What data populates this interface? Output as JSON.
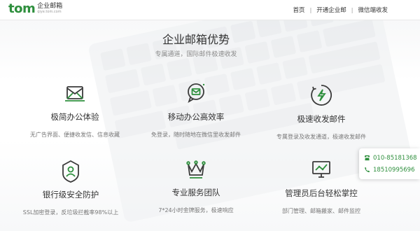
{
  "header": {
    "logo_brand": "tom",
    "logo_cn": "企业邮箱",
    "logo_en": "qiye.tom.com",
    "nav": [
      "首页",
      "开通企业邮",
      "微信端收发"
    ]
  },
  "section": {
    "title": "企业邮箱优势",
    "subtitle": "专属通道，国际邮件极速收发"
  },
  "features": [
    {
      "icon": "mailbox-icon",
      "title": "极简办公体验",
      "desc": "无广告界面、便捷收发信、信息收藏"
    },
    {
      "icon": "chat-bubble-icon",
      "title": "移动办公高效率",
      "desc": "免登录，随时随地在微信里收发邮件"
    },
    {
      "icon": "lightning-icon",
      "title": "极速收发邮件",
      "desc": "专属登录及收发通道，极速收发邮件"
    },
    {
      "icon": "shield-user-icon",
      "title": "银行级安全防护",
      "desc": "SSL加密登录，反垃圾拦截率98%以上"
    },
    {
      "icon": "crown-icon",
      "title": "专业服务团队",
      "desc": "7*24小时金牌服务，极速响应"
    },
    {
      "icon": "monitor-chart-icon",
      "title": "管理员后台轻松掌控",
      "desc": "部门管理、邮箱搬家、邮件监控"
    }
  ],
  "contact": {
    "phone1": "010-85181368",
    "phone2": "18510995696"
  },
  "colors": {
    "brand_green": "#2e8f3d",
    "icon_dark": "#3b3b3b"
  }
}
